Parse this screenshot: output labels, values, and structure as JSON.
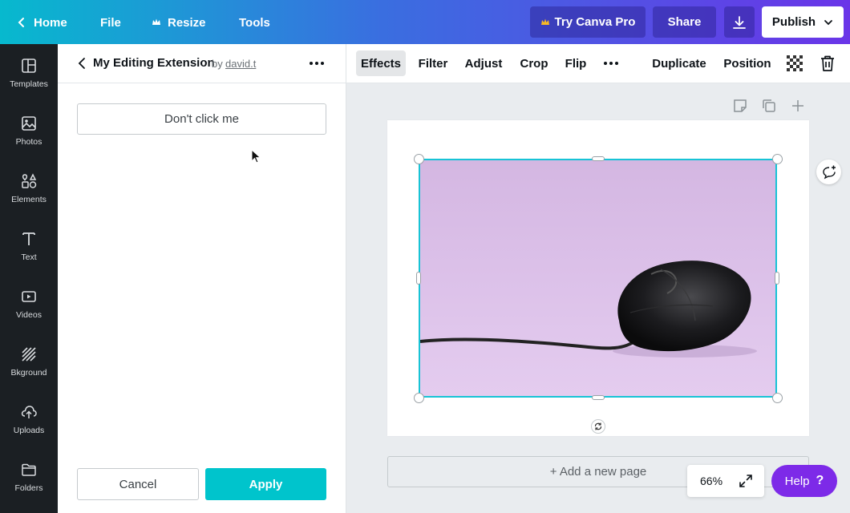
{
  "topbar": {
    "home_label": "Home",
    "file_label": "File",
    "resize_label": "Resize",
    "tools_label": "Tools",
    "try_pro_label": "Try Canva Pro",
    "share_label": "Share",
    "publish_label": "Publish"
  },
  "sidebar": {
    "items": [
      {
        "label": "Templates",
        "icon": "templates-icon"
      },
      {
        "label": "Photos",
        "icon": "photos-icon"
      },
      {
        "label": "Elements",
        "icon": "elements-icon"
      },
      {
        "label": "Text",
        "icon": "text-icon"
      },
      {
        "label": "Videos",
        "icon": "videos-icon"
      },
      {
        "label": "Bkground",
        "icon": "background-icon"
      },
      {
        "label": "Uploads",
        "icon": "uploads-icon"
      },
      {
        "label": "Folders",
        "icon": "folders-icon"
      }
    ]
  },
  "panel": {
    "title": "My Editing Extension",
    "by_label": "by",
    "author": "david.t",
    "dont_click_label": "Don't click me",
    "cancel_label": "Cancel",
    "apply_label": "Apply"
  },
  "toolbar": {
    "effects_label": "Effects",
    "filter_label": "Filter",
    "adjust_label": "Adjust",
    "crop_label": "Crop",
    "flip_label": "Flip",
    "duplicate_label": "Duplicate",
    "position_label": "Position"
  },
  "canvas": {
    "add_page_label": "+ Add a new page",
    "zoom_label": "66%",
    "help_label": "Help",
    "help_mark": "?"
  },
  "colors": {
    "accent": "#00c4cc",
    "selection": "#18c3d6",
    "help": "#7d2ae8",
    "pro_crown": "#f7b924"
  }
}
